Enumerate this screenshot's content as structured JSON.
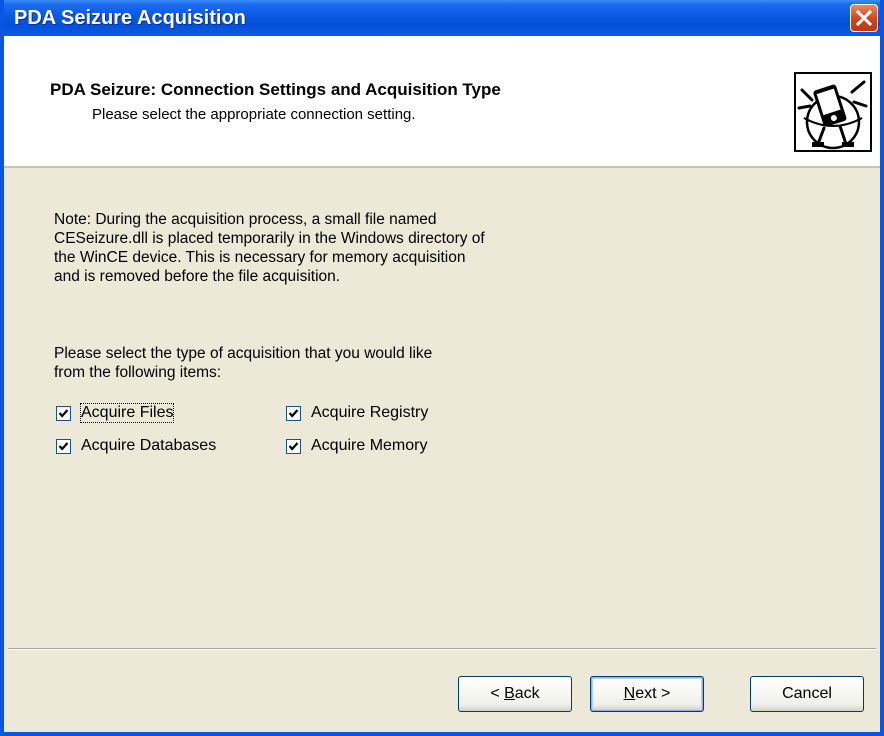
{
  "window": {
    "title": "PDA Seizure Acquisition"
  },
  "header": {
    "title": "PDA Seizure: Connection Settings and Acquisition Type",
    "subtitle": "Please select the appropriate connection setting."
  },
  "note": {
    "lines": [
      "Note:  During the acquisition process, a small file named",
      "CESeizure.dll is placed temporarily in the Windows directory of",
      "the WinCE device.  This is necessary for memory acquisition",
      "and is removed before the file acquisition."
    ]
  },
  "instruction": {
    "lines": [
      "Please select the type of acquisition that you would like",
      "from the following items:"
    ]
  },
  "options": [
    {
      "label": "Acquire Files",
      "checked": true
    },
    {
      "label": "Acquire Registry",
      "checked": true
    },
    {
      "label": "Acquire Databases",
      "checked": true
    },
    {
      "label": "Acquire Memory",
      "checked": true
    }
  ],
  "buttons": {
    "back": {
      "accel": "B",
      "rest": "ack",
      "prefix": "< "
    },
    "next": {
      "accel": "N",
      "rest": "ext >"
    },
    "cancel": {
      "label": "Cancel"
    }
  },
  "icons": {
    "close": "close-icon",
    "logo": "pda-wizard-logo-icon",
    "check": "checkmark-icon"
  },
  "colors": {
    "titlebar": "#0A58E0",
    "close": "#D0441C",
    "dialog": "#ECE9D8"
  }
}
